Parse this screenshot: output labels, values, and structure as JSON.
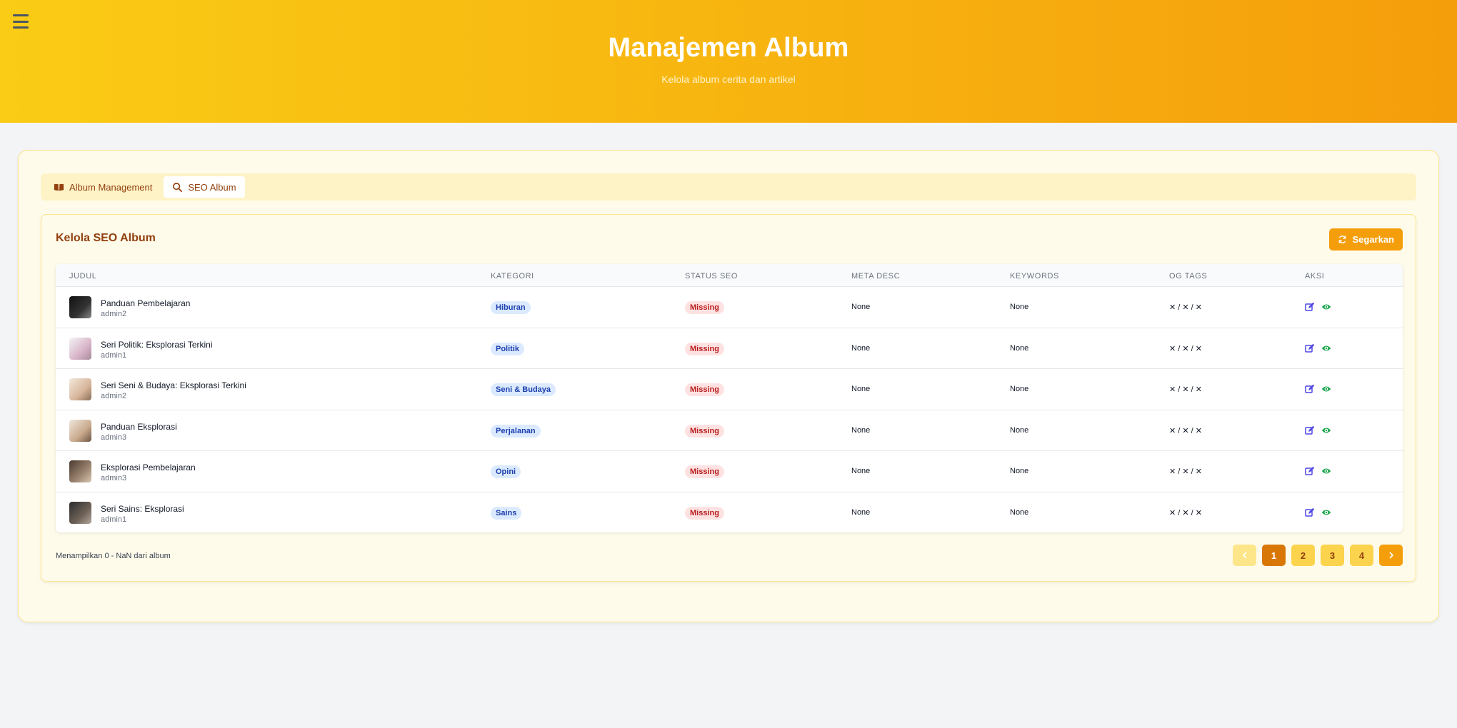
{
  "header": {
    "title": "Manajemen Album",
    "subtitle": "Kelola album cerita dan artikel"
  },
  "tabs": [
    {
      "label": "Album Management",
      "icon": "book-icon"
    },
    {
      "label": "SEO Album",
      "icon": "search-icon",
      "active": true
    }
  ],
  "panel": {
    "title": "Kelola SEO Album",
    "refresh_label": "Segarkan"
  },
  "table": {
    "headers": [
      "JUDUL",
      "KATEGORI",
      "STATUS SEO",
      "META DESC",
      "KEYWORDS",
      "OG TAGS",
      "AKSI"
    ],
    "rows": [
      {
        "title": "Panduan Pembelajaran",
        "author": "admin2",
        "category": "Hiburan",
        "status": "Missing",
        "meta": "None",
        "keywords": "None",
        "og": "✕ / ✕ / ✕"
      },
      {
        "title": "Seri Politik: Eksplorasi Terkini",
        "author": "admin1",
        "category": "Politik",
        "status": "Missing",
        "meta": "None",
        "keywords": "None",
        "og": "✕ / ✕ / ✕"
      },
      {
        "title": "Seri Seni & Budaya: Eksplorasi Terkini",
        "author": "admin2",
        "category": "Seni & Budaya",
        "status": "Missing",
        "meta": "None",
        "keywords": "None",
        "og": "✕ / ✕ / ✕"
      },
      {
        "title": "Panduan Eksplorasi",
        "author": "admin3",
        "category": "Perjalanan",
        "status": "Missing",
        "meta": "None",
        "keywords": "None",
        "og": "✕ / ✕ / ✕"
      },
      {
        "title": "Eksplorasi Pembelajaran",
        "author": "admin3",
        "category": "Opini",
        "status": "Missing",
        "meta": "None",
        "keywords": "None",
        "og": "✕ / ✕ / ✕"
      },
      {
        "title": "Seri Sains: Eksplorasi",
        "author": "admin1",
        "category": "Sains",
        "status": "Missing",
        "meta": "None",
        "keywords": "None",
        "og": "✕ / ✕ / ✕"
      }
    ]
  },
  "footer": {
    "summary": "Menampilkan 0 - NaN dari album"
  },
  "pagination": {
    "pages": [
      "1",
      "2",
      "3",
      "4"
    ],
    "current": "1"
  },
  "colors": {
    "header_start": "#facc15",
    "header_end": "#f59e0b",
    "accent": "#f59e0b",
    "category_badge": "#dbeafe",
    "status_missing": "#fee2e2",
    "edit_icon": "#4f46e5",
    "view_icon": "#16a34a"
  }
}
